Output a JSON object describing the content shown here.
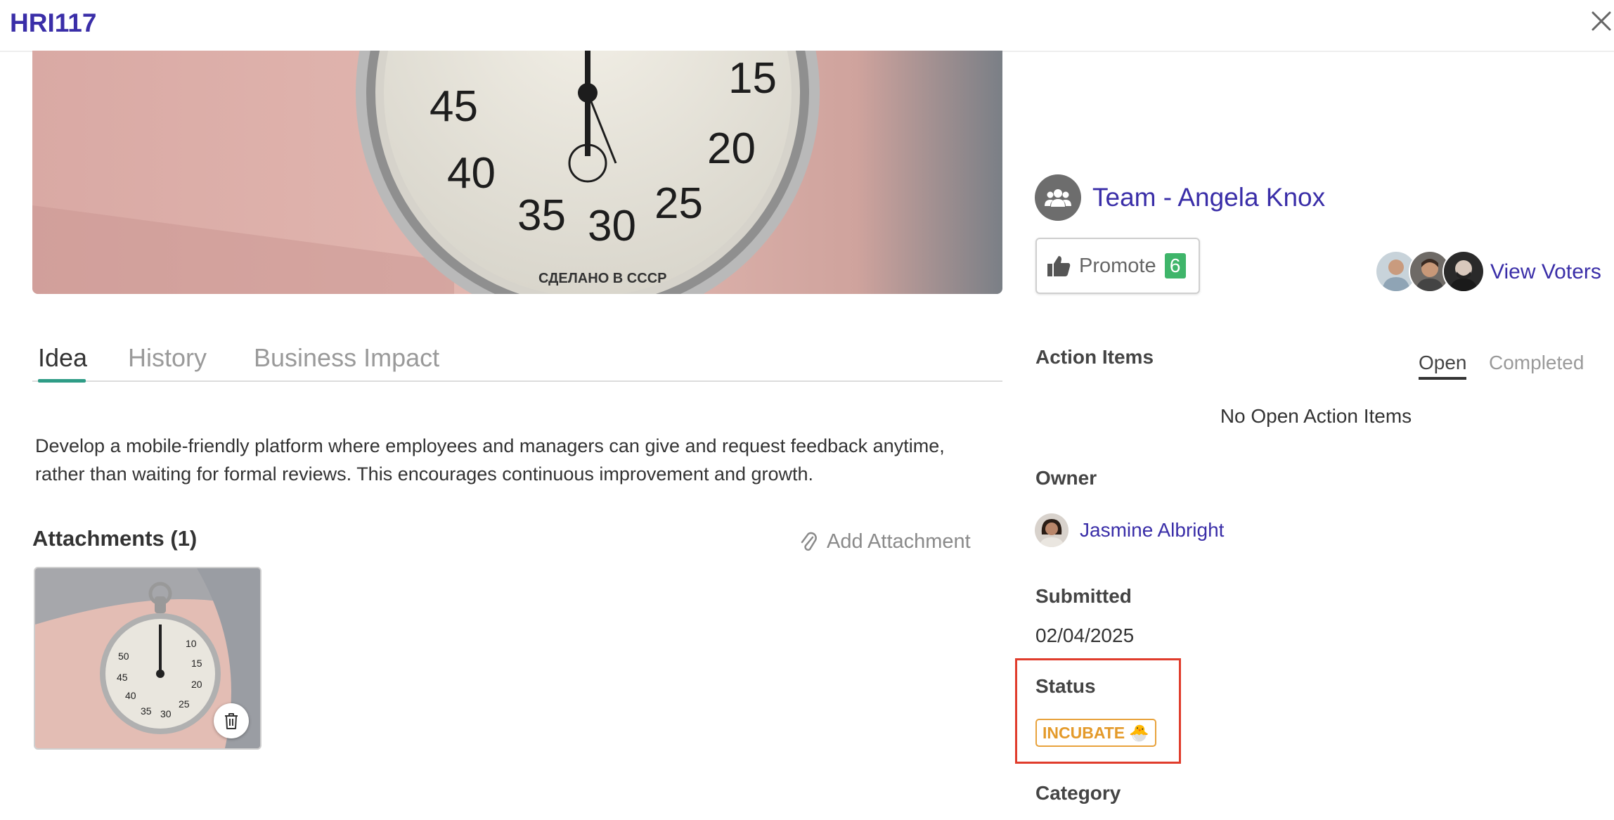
{
  "header": {
    "title": "HRI117"
  },
  "tabs": [
    {
      "label": "Idea"
    },
    {
      "label": "History"
    },
    {
      "label": "Business Impact"
    }
  ],
  "idea": {
    "description": "Develop a mobile-friendly platform where employees and managers can give and request feedback anytime, rather than waiting for formal reviews. This encourages continuous improvement and growth."
  },
  "attachments": {
    "title": "Attachments (1)",
    "add_label": "Add Attachment"
  },
  "team": {
    "name": "Team - Angela Knox"
  },
  "promote": {
    "label": "Promote",
    "count": "6"
  },
  "voters": {
    "view_label": "View Voters"
  },
  "action_items": {
    "label": "Action Items",
    "tabs": [
      "Open",
      "Completed"
    ],
    "empty_text": "No Open Action Items"
  },
  "owner": {
    "label": "Owner",
    "name": "Jasmine Albright"
  },
  "submitted": {
    "label": "Submitted",
    "date": "02/04/2025"
  },
  "status": {
    "label": "Status",
    "value": "INCUBATE",
    "emoji": "🐣",
    "color": "#e49a2a"
  },
  "category": {
    "label": "Category"
  },
  "colors": {
    "accent": "#3a2ea8",
    "tab_underline": "#2e9c86",
    "promote_count": "#3fb56a",
    "highlight": "#e03c2c"
  }
}
